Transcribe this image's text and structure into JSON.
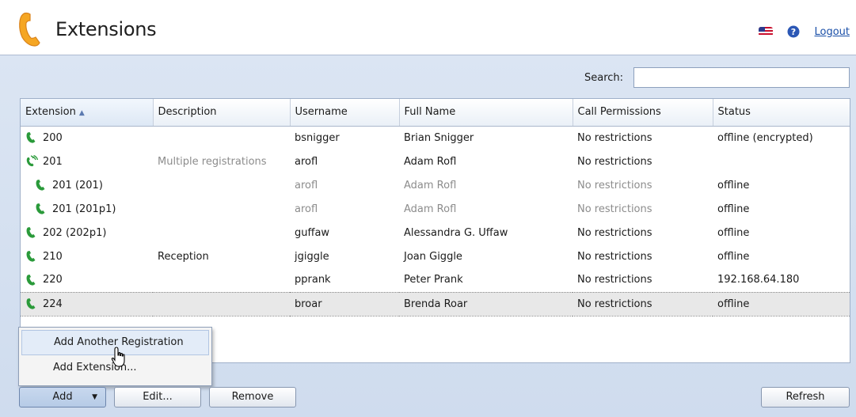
{
  "header": {
    "title": "Extensions",
    "logo_icon": "phone-handset-icon",
    "flag_icon": "us-flag-icon",
    "help_icon": "help-icon",
    "logout_label": "Logout"
  },
  "search": {
    "label": "Search:",
    "value": ""
  },
  "table": {
    "columns": [
      "Extension",
      "Description",
      "Username",
      "Full Name",
      "Call Permissions",
      "Status"
    ],
    "sorted_column": "Extension",
    "rows": [
      {
        "extension": "200",
        "description": "",
        "username": "bsnigger",
        "full_name": "Brian Snigger",
        "call_permissions": "No restrictions",
        "status": "offline (encrypted)"
      },
      {
        "extension": "201",
        "description": "Multiple registrations",
        "username": "arofl",
        "full_name": "Adam Rofl",
        "call_permissions": "No restrictions",
        "status": ""
      },
      {
        "extension": "201 (201)",
        "description": "",
        "username": "arofl",
        "full_name": "Adam Rofl",
        "call_permissions": "No restrictions",
        "status": "offline"
      },
      {
        "extension": "201 (201p1)",
        "description": "",
        "username": "arofl",
        "full_name": "Adam Rofl",
        "call_permissions": "No restrictions",
        "status": "offline"
      },
      {
        "extension": "202 (202p1)",
        "description": "",
        "username": "guffaw",
        "full_name": "Alessandra G. Uffaw",
        "call_permissions": "No restrictions",
        "status": "offline"
      },
      {
        "extension": "210",
        "description": "Reception",
        "username": "jgiggle",
        "full_name": "Joan Giggle",
        "call_permissions": "No restrictions",
        "status": "offline"
      },
      {
        "extension": "220",
        "description": "",
        "username": "pprank",
        "full_name": "Peter Prank",
        "call_permissions": "No restrictions",
        "status": "192.168.64.180"
      },
      {
        "extension": "224",
        "description": "",
        "username": "broar",
        "full_name": "Brenda Roar",
        "call_permissions": "No restrictions",
        "status": "offline"
      }
    ]
  },
  "menu": {
    "items": [
      "Add Another Registration",
      "Add Extension..."
    ]
  },
  "buttons": {
    "add": "Add",
    "edit": "Edit...",
    "remove": "Remove",
    "refresh": "Refresh"
  },
  "colors": {
    "accent_green": "#2a9a3a",
    "panel_bg": "#d5e1f1",
    "link_blue": "#1a4fa8"
  }
}
